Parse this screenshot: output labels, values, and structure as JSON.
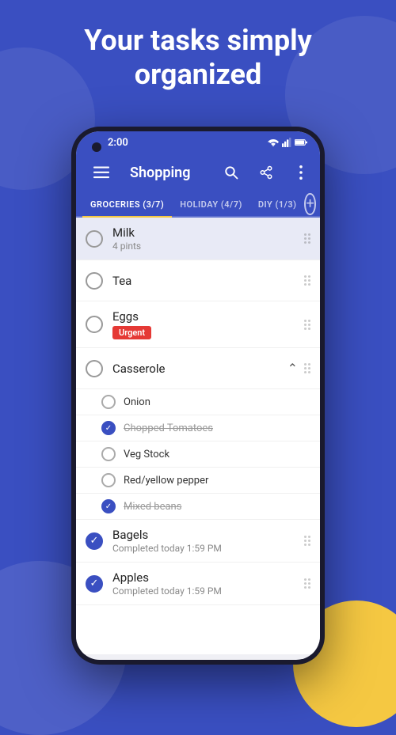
{
  "hero": {
    "title": "Your tasks simply organized"
  },
  "status_bar": {
    "time": "2:00",
    "signal": "signal-icon",
    "wifi": "wifi-icon",
    "battery": "battery-icon"
  },
  "app_bar": {
    "title": "Shopping",
    "menu_icon": "menu-icon",
    "search_icon": "search-icon",
    "share_icon": "share-icon",
    "more_icon": "more-icon"
  },
  "tabs": [
    {
      "label": "GROCERIES (3/7)",
      "active": true
    },
    {
      "label": "HOLIDAY (4/7)",
      "active": false
    },
    {
      "label": "DIY (1/3)",
      "active": false
    }
  ],
  "add_tab_label": "+",
  "tasks": [
    {
      "id": "milk",
      "name": "Milk",
      "sub": "4 pints",
      "checked": false,
      "highlighted": true,
      "tag": null,
      "strikethrough": false
    },
    {
      "id": "tea",
      "name": "Tea",
      "sub": null,
      "checked": false,
      "highlighted": false,
      "tag": null,
      "strikethrough": false
    },
    {
      "id": "eggs",
      "name": "Eggs",
      "sub": null,
      "checked": false,
      "highlighted": false,
      "tag": "Urgent",
      "strikethrough": false
    },
    {
      "id": "casserole",
      "name": "Casserole",
      "sub": null,
      "checked": false,
      "highlighted": false,
      "tag": null,
      "strikethrough": false,
      "has_subtasks": true
    }
  ],
  "subtasks": [
    {
      "name": "Onion",
      "checked": false,
      "strikethrough": false
    },
    {
      "name": "Chopped Tomatoes",
      "checked": true,
      "strikethrough": true
    },
    {
      "name": "Veg Stock",
      "checked": false,
      "strikethrough": false
    },
    {
      "name": "Red/yellow pepper",
      "checked": false,
      "strikethrough": false
    },
    {
      "name": "Mixed beans",
      "checked": true,
      "strikethrough": true
    }
  ],
  "completed_tasks": [
    {
      "id": "bagels",
      "name": "Bagels",
      "sub": "Completed today 1:59 PM",
      "checked": true
    },
    {
      "id": "apples",
      "name": "Apples",
      "sub": "Completed today 1:59 PM",
      "checked": true
    }
  ],
  "colors": {
    "primary": "#3a4fc1",
    "accent": "#f5c842",
    "urgent": "#e53935"
  }
}
